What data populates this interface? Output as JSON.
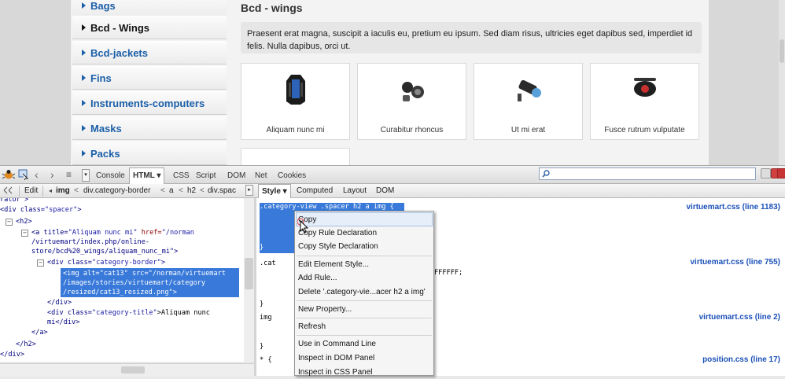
{
  "sidebar": {
    "items": [
      {
        "label": "Bags"
      },
      {
        "label": "Bcd - Wings"
      },
      {
        "label": "Bcd-jackets"
      },
      {
        "label": "Fins"
      },
      {
        "label": "Instruments-computers"
      },
      {
        "label": "Masks"
      },
      {
        "label": "Packs"
      }
    ]
  },
  "content": {
    "title": "Bcd - wings",
    "description": "Praesent erat magna, suscipit a iaculis eu, pretium eu ipsum. Sed diam risus, ultricies eget dapibus sed, imperdiet id felis. Nulla dapibus, orci ut.",
    "products": [
      {
        "title": "Aliquam nunc mi"
      },
      {
        "title": "Curabitur rhoncus"
      },
      {
        "title": "Ut mi erat"
      },
      {
        "title": "Fusce rutrum vulputate"
      }
    ]
  },
  "firebug": {
    "tabs": [
      "Console",
      "HTML ▾",
      "CSS",
      "Script",
      "DOM",
      "Net",
      "Cookies"
    ],
    "edit_label": "Edit",
    "breadcrumb": [
      "img",
      "div.category-border",
      "a",
      "h2",
      "div.spac"
    ],
    "side_tabs": [
      "Style ▾",
      "Computed",
      "Layout",
      "DOM"
    ],
    "html_lines": {
      "l0": "rator\">",
      "l1a": "<div class=",
      "l1b": "\"spacer\"",
      "l1c": ">",
      "l2": "<h2>",
      "l3a": "<a title=",
      "l3b": "\"Aliquam nunc mi\"",
      "l3c": " href=",
      "l3d": "\"/norman",
      "l4": "/virtuemart/index.php/online-",
      "l5": "store/bcd%20_wings/aliquam_nunc_mi\">",
      "l6a": "<div class=",
      "l6b": "\"category-border\"",
      "l6c": ">",
      "l7": "<img alt=\"cat13\" src=\"/norman/virtuemart",
      "l8": "/images/stories/virtuemart/category",
      "l9": "/resized/cat13_resized.png\">",
      "l10": "</div>",
      "l11a": "<div class=",
      "l11b": "\"category-title\"",
      "l11c": ">Aliquam nunc",
      "l12": "mi</div>",
      "l13": "</a>",
      "l14": "</h2>",
      "l15": "</div>"
    },
    "style_rules": {
      "r1": ".category-view .spacer h2 a img {",
      "r2": ".cat",
      "r3": "FFFFFF;",
      "r4": "}",
      "r5": "img",
      "r6": "}",
      "r7": "* {"
    },
    "sources": [
      "virtuemart.css (line 1183)",
      "virtuemart.css (line 755)",
      "virtuemart.css (line 2)",
      "position.css (line 17)"
    ]
  },
  "context_menu": {
    "items": [
      "Copy",
      "Copy Rule Declaration",
      "Copy Style Declaration",
      "Edit Element Style...",
      "Add Rule...",
      "Delete '.category-vie...acer h2 a img'",
      "New Property...",
      "Refresh",
      "Use in Command Line",
      "Inspect in DOM Panel",
      "Inspect in CSS Panel"
    ]
  }
}
